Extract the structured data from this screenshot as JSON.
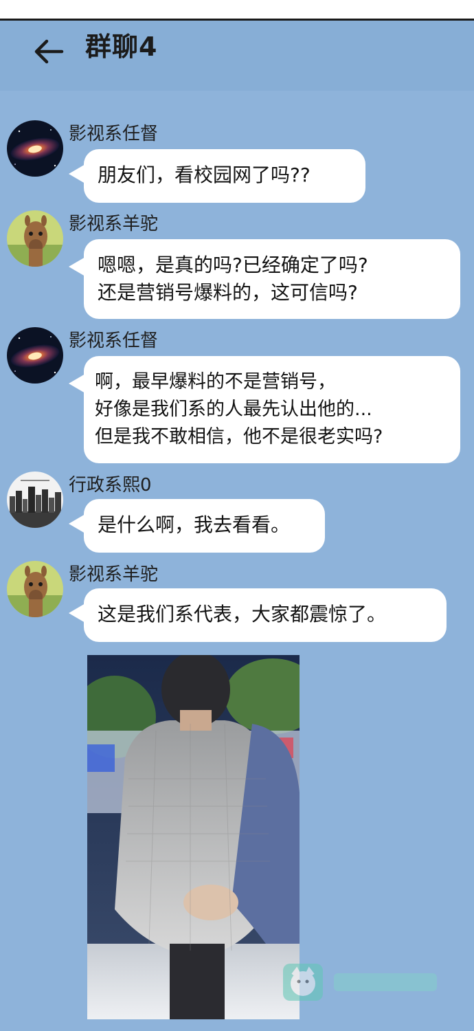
{
  "header": {
    "title": "群聊4",
    "back_icon": "arrow-left-icon"
  },
  "messages": [
    {
      "sender": "影视系任督",
      "avatar": "galaxy-avatar",
      "lines": [
        "朋友们，看校园网了吗??"
      ]
    },
    {
      "sender": "影视系羊驼",
      "avatar": "alpaca-avatar",
      "lines": [
        "嗯嗯，是真的吗?已经确定了吗?",
        "还是营销号爆料的，这可信吗?"
      ]
    },
    {
      "sender": "影视系任督",
      "avatar": "galaxy-avatar",
      "lines": [
        "啊，最早爆料的不是营销号，",
        "好像是我们系的人最先认出他的...",
        "但是我不敢相信，他不是很老实吗?"
      ]
    },
    {
      "sender": "行政系熙0",
      "avatar": "city-skyline-avatar",
      "lines": [
        "是什么啊，我去看看。"
      ]
    },
    {
      "sender": "影视系羊驼",
      "avatar": "alpaca-avatar",
      "lines": [
        "这是我们系代表，大家都震惊了。"
      ]
    }
  ],
  "shared_image": {
    "description_icon": "arrest-photo-image"
  },
  "colors": {
    "background": "#8eb3da",
    "header": "#87aed6",
    "bubble": "#ffffff"
  }
}
